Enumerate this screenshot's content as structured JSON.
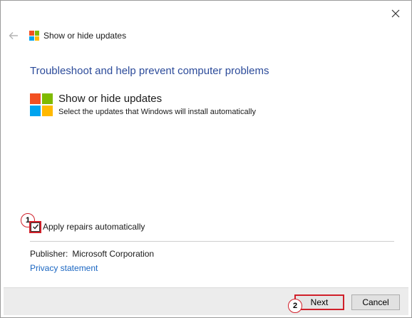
{
  "window": {
    "title": "Show or hide updates"
  },
  "main": {
    "heading": "Troubleshoot and help prevent computer problems",
    "troubleshooter": {
      "title": "Show or hide updates",
      "description": "Select the updates that Windows will install automatically"
    },
    "apply_repairs": {
      "label": "Apply repairs automatically",
      "checked": true
    },
    "publisher": {
      "label": "Publisher:",
      "value": "Microsoft Corporation"
    },
    "privacy_link": "Privacy statement"
  },
  "footer": {
    "next_label": "Next",
    "cancel_label": "Cancel"
  },
  "annotations": {
    "marker1": "1",
    "marker2": "2",
    "color": "#d0202a"
  },
  "icons": {
    "close": "close-icon",
    "back": "back-arrow-icon",
    "logo": "windows-logo-icon",
    "check": "checkmark-icon"
  }
}
